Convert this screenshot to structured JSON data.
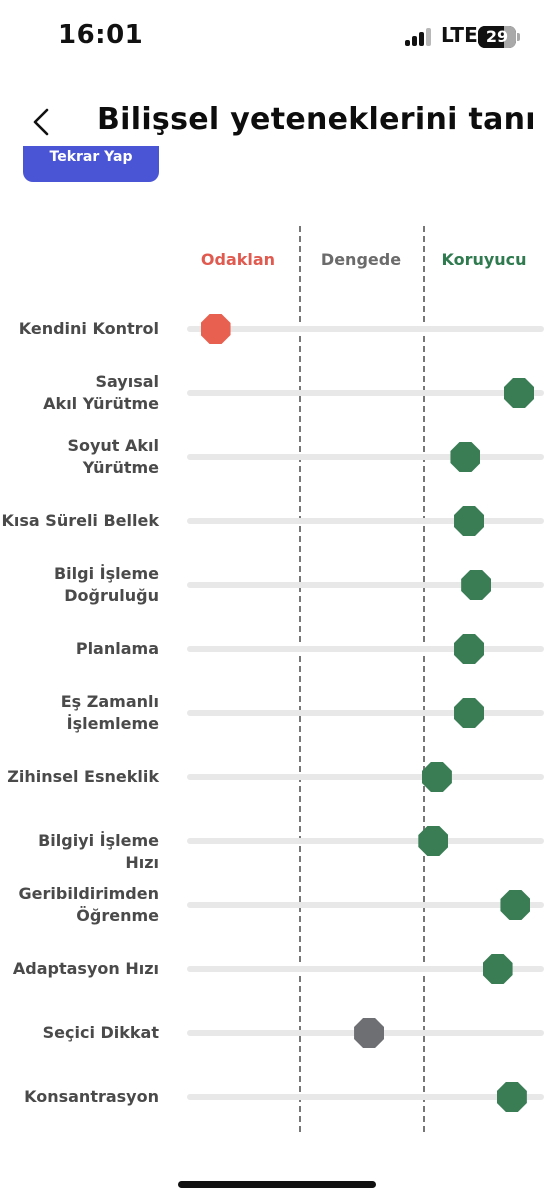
{
  "status_bar": {
    "time": "16:01",
    "network": "LTE",
    "battery": "29"
  },
  "header": {
    "title": "Bilişsel yeteneklerini tanı",
    "back_icon": "chevron-left-icon"
  },
  "cta_button": {
    "label": "Tekrar Yap"
  },
  "columns": [
    {
      "label": "Odaklan",
      "color": "#e15a4f"
    },
    {
      "label": "Dengede",
      "color": "#6b6b6b"
    },
    {
      "label": "Koruyucu",
      "color": "#2f7a4e"
    }
  ],
  "colors": {
    "focus": "#e8604f",
    "balance": "#6d6f72",
    "protective": "#3a7d55",
    "track": "#e8e8e8"
  },
  "skills": [
    {
      "label": "Kendini Kontrol",
      "score": 0.08,
      "status": "focus"
    },
    {
      "label": "Sayısal\nAkıl Yürütme",
      "score": 0.93,
      "status": "protective"
    },
    {
      "label": "Soyut Akıl\nYürütme",
      "score": 0.78,
      "status": "protective"
    },
    {
      "label": "Kısa Süreli Bellek",
      "score": 0.79,
      "status": "protective"
    },
    {
      "label": "Bilgi İşleme\nDoğruluğu",
      "score": 0.81,
      "status": "protective"
    },
    {
      "label": "Planlama",
      "score": 0.79,
      "status": "protective"
    },
    {
      "label": "Eş Zamanlı\nİşlemleme",
      "score": 0.79,
      "status": "protective"
    },
    {
      "label": "Zihinsel Esneklik",
      "score": 0.7,
      "status": "protective"
    },
    {
      "label": "Bilgiyi İşleme Hızı",
      "score": 0.69,
      "status": "protective"
    },
    {
      "label": "Geribildirimden\nÖğrenme",
      "score": 0.92,
      "status": "protective"
    },
    {
      "label": "Adaptasyon Hızı",
      "score": 0.87,
      "status": "protective"
    },
    {
      "label": "Seçici Dikkat",
      "score": 0.51,
      "status": "balance"
    },
    {
      "label": "Konsantrasyon",
      "score": 0.91,
      "status": "protective"
    }
  ]
}
